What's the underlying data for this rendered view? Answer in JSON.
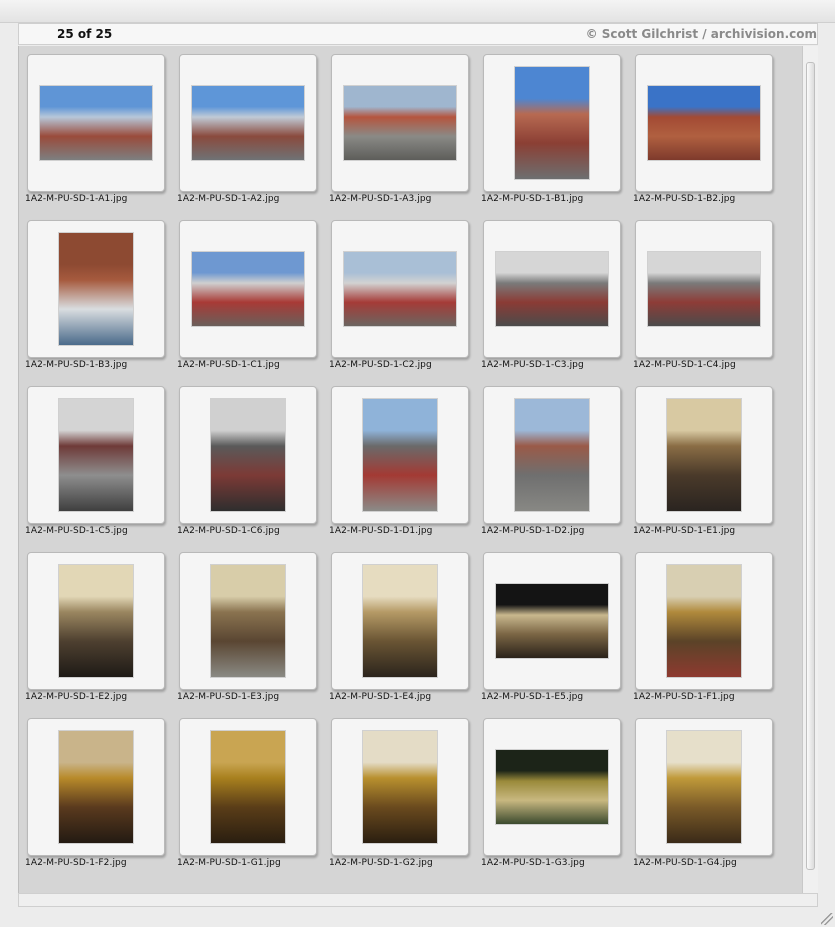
{
  "header": {
    "counter": "25 of 25",
    "copyright": "© Scott Gilchrist / archivision.com"
  },
  "slides": [
    {
      "file": "1A2-M-PU-SD-1-A1.jpg",
      "orientation": "landscape",
      "colors": [
        "#5f95d6",
        "#b7c7d9",
        "#9a4b3b",
        "#7d7f80"
      ]
    },
    {
      "file": "1A2-M-PU-SD-1-A2.jpg",
      "orientation": "landscape",
      "colors": [
        "#5e96d8",
        "#c0cad6",
        "#8a4a3d",
        "#6f7275"
      ]
    },
    {
      "file": "1A2-M-PU-SD-1-A3.jpg",
      "orientation": "landscape",
      "colors": [
        "#9fb6cf",
        "#b5553e",
        "#8a8a86",
        "#5d5d5a"
      ]
    },
    {
      "file": "1A2-M-PU-SD-1-B1.jpg",
      "orientation": "portrait",
      "colors": [
        "#4d86d2",
        "#b76a52",
        "#8b3f34",
        "#6d6f70"
      ]
    },
    {
      "file": "1A2-M-PU-SD-1-B2.jpg",
      "orientation": "landscape",
      "colors": [
        "#3a73c7",
        "#a34a34",
        "#b06040",
        "#7e3a2c"
      ]
    },
    {
      "file": "1A2-M-PU-SD-1-B3.jpg",
      "orientation": "portrait",
      "colors": [
        "#8d4a32",
        "#a65a3e",
        "#d9dde0",
        "#4a6a8a"
      ]
    },
    {
      "file": "1A2-M-PU-SD-1-C1.jpg",
      "orientation": "landscape",
      "colors": [
        "#6e98d1",
        "#cfcfcf",
        "#a83a36",
        "#6a5f5a"
      ]
    },
    {
      "file": "1A2-M-PU-SD-1-C2.jpg",
      "orientation": "landscape",
      "colors": [
        "#a9bfd6",
        "#d2d2d2",
        "#a53b37",
        "#6b6560"
      ]
    },
    {
      "file": "1A2-M-PU-SD-1-C3.jpg",
      "orientation": "landscape",
      "colors": [
        "#d6d6d6",
        "#7a7a7a",
        "#8b3b35",
        "#4b4b4b"
      ]
    },
    {
      "file": "1A2-M-PU-SD-1-C4.jpg",
      "orientation": "landscape",
      "colors": [
        "#d6d6d6",
        "#7a7a7a",
        "#8e3c37",
        "#4b4b4b"
      ]
    },
    {
      "file": "1A2-M-PU-SD-1-C5.jpg",
      "orientation": "portrait",
      "colors": [
        "#d4d4d4",
        "#6e3a38",
        "#8e8e8e",
        "#3f3f3f"
      ]
    },
    {
      "file": "1A2-M-PU-SD-1-C6.jpg",
      "orientation": "portrait",
      "colors": [
        "#d0d0d0",
        "#5a5a5a",
        "#7c3a36",
        "#2e2e2e"
      ]
    },
    {
      "file": "1A2-M-PU-SD-1-D1.jpg",
      "orientation": "portrait",
      "colors": [
        "#8fb3d9",
        "#6a6a6a",
        "#a33a34",
        "#8b8b88"
      ]
    },
    {
      "file": "1A2-M-PU-SD-1-D2.jpg",
      "orientation": "portrait",
      "colors": [
        "#9cb8d8",
        "#9a5a48",
        "#6f6f6f",
        "#888884"
      ]
    },
    {
      "file": "1A2-M-PU-SD-1-E1.jpg",
      "orientation": "portrait",
      "colors": [
        "#d8c9a2",
        "#8a6d45",
        "#4a3a2a",
        "#2a2420"
      ]
    },
    {
      "file": "1A2-M-PU-SD-1-E2.jpg",
      "orientation": "portrait",
      "colors": [
        "#e2d7b6",
        "#9a8660",
        "#4e4030",
        "#1e1a16"
      ]
    },
    {
      "file": "1A2-M-PU-SD-1-E3.jpg",
      "orientation": "portrait",
      "colors": [
        "#d8cda9",
        "#8a7350",
        "#5a4632",
        "#8a8a84"
      ]
    },
    {
      "file": "1A2-M-PU-SD-1-E4.jpg",
      "orientation": "portrait",
      "colors": [
        "#e6dcc0",
        "#b59a66",
        "#6a5534",
        "#2b241c"
      ]
    },
    {
      "file": "1A2-M-PU-SD-1-E5.jpg",
      "orientation": "landscape",
      "colors": [
        "#141414",
        "#c9b88e",
        "#7a6544",
        "#2a221a"
      ]
    },
    {
      "file": "1A2-M-PU-SD-1-F1.jpg",
      "orientation": "portrait",
      "colors": [
        "#d8cfb2",
        "#b08a3c",
        "#5b4328",
        "#8e3a30"
      ]
    },
    {
      "file": "1A2-M-PU-SD-1-F2.jpg",
      "orientation": "portrait",
      "colors": [
        "#c9b48a",
        "#b88a2a",
        "#5a3a1e",
        "#231a12"
      ]
    },
    {
      "file": "1A2-M-PU-SD-1-G1.jpg",
      "orientation": "portrait",
      "colors": [
        "#c9a552",
        "#a8801e",
        "#5a3d18",
        "#2a1e10"
      ]
    },
    {
      "file": "1A2-M-PU-SD-1-G2.jpg",
      "orientation": "portrait",
      "colors": [
        "#e4dcc6",
        "#b8902e",
        "#6a4a1e",
        "#2a1e10"
      ]
    },
    {
      "file": "1A2-M-PU-SD-1-G3.jpg",
      "orientation": "landscape",
      "colors": [
        "#1c2418",
        "#9a8a3a",
        "#c8b880",
        "#3b4a2e"
      ]
    },
    {
      "file": "1A2-M-PU-SD-1-G4.jpg",
      "orientation": "portrait",
      "colors": [
        "#e6dfca",
        "#c09a3a",
        "#7a5a28",
        "#3a2a18"
      ]
    }
  ]
}
